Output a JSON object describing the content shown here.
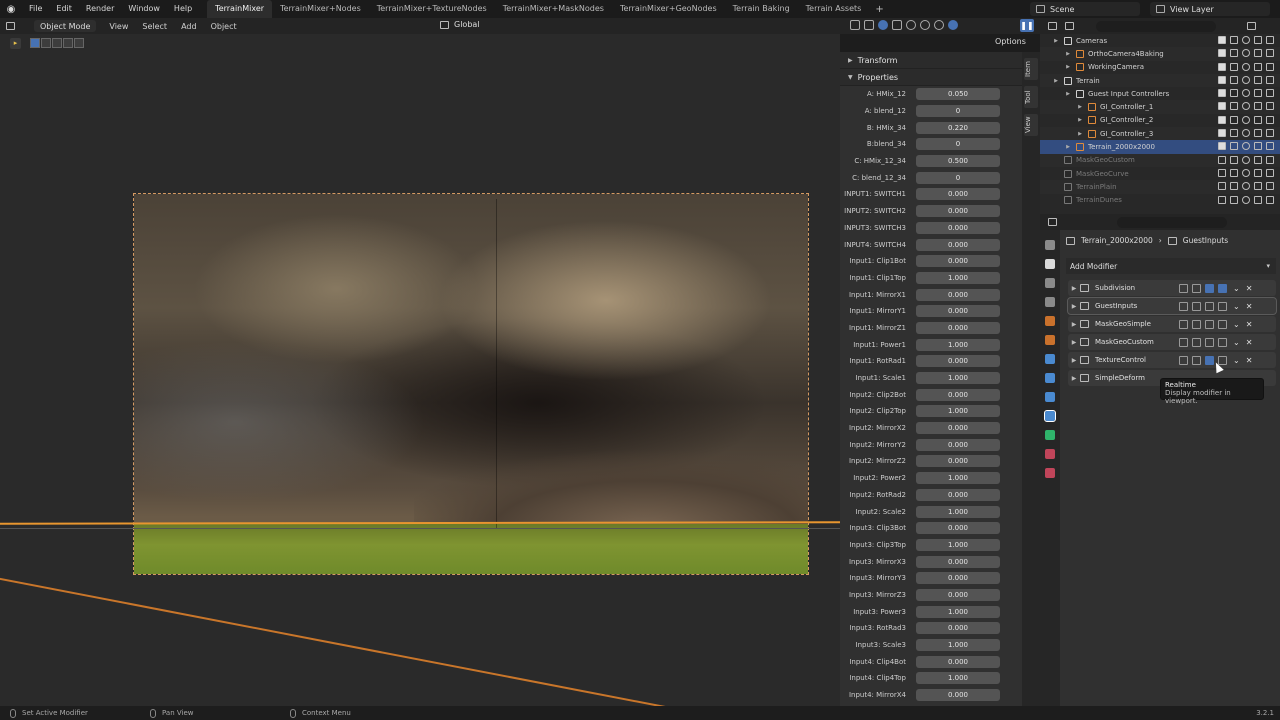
{
  "menubar": {
    "items": [
      "File",
      "Edit",
      "Render",
      "Window",
      "Help"
    ],
    "workspaces": [
      "TerrainMixer",
      "TerrainMixer+Nodes",
      "TerrainMixer+TextureNodes",
      "TerrainMixer+MaskNodes",
      "TerrainMixer+GeoNodes",
      "Terrain Baking",
      "Terrain Assets"
    ],
    "active_workspace": "TerrainMixer",
    "add_tab": "+",
    "scene": "Scene",
    "view_layer": "View Layer"
  },
  "viewport_header": {
    "mode": "Object Mode",
    "menus": [
      "View",
      "Select",
      "Add",
      "Object"
    ],
    "orientation": "Global",
    "options": "Options"
  },
  "sidebar": {
    "sections": {
      "transform": "Transform",
      "properties": "Properties"
    },
    "tabs": [
      "Item",
      "Tool",
      "View"
    ],
    "properties": [
      {
        "label": "A: HMix_12",
        "value": "0.050"
      },
      {
        "label": "A: blend_12",
        "value": "0"
      },
      {
        "label": "B: HMix_34",
        "value": "0.220"
      },
      {
        "label": "B:blend_34",
        "value": "0"
      },
      {
        "label": "C: HMix_12_34",
        "value": "0.500"
      },
      {
        "label": "C: blend_12_34",
        "value": "0"
      },
      {
        "label": "INPUT1: SWITCH1",
        "value": "0.000"
      },
      {
        "label": "INPUT2: SWITCH2",
        "value": "0.000"
      },
      {
        "label": "INPUT3: SWITCH3",
        "value": "0.000"
      },
      {
        "label": "INPUT4: SWITCH4",
        "value": "0.000"
      },
      {
        "label": "Input1: Clip1Bot",
        "value": "0.000"
      },
      {
        "label": "Input1: Clip1Top",
        "value": "1.000"
      },
      {
        "label": "Input1: MirrorX1",
        "value": "0.000"
      },
      {
        "label": "Input1: MirrorY1",
        "value": "0.000"
      },
      {
        "label": "Input1: MirrorZ1",
        "value": "0.000"
      },
      {
        "label": "Input1: Power1",
        "value": "1.000"
      },
      {
        "label": "Input1: RotRad1",
        "value": "0.000"
      },
      {
        "label": "Input1: Scale1",
        "value": "1.000"
      },
      {
        "label": "Input2: Clip2Bot",
        "value": "0.000"
      },
      {
        "label": "Input2: Clip2Top",
        "value": "1.000"
      },
      {
        "label": "Input2: MirrorX2",
        "value": "0.000"
      },
      {
        "label": "Input2: MirrorY2",
        "value": "0.000"
      },
      {
        "label": "Input2: MirrorZ2",
        "value": "0.000"
      },
      {
        "label": "Input2: Power2",
        "value": "1.000"
      },
      {
        "label": "Input2: RotRad2",
        "value": "0.000"
      },
      {
        "label": "Input2: Scale2",
        "value": "1.000"
      },
      {
        "label": "Input3: Clip3Bot",
        "value": "0.000"
      },
      {
        "label": "Input3: Clip3Top",
        "value": "1.000"
      },
      {
        "label": "Input3: MirrorX3",
        "value": "0.000"
      },
      {
        "label": "Input3: MirrorY3",
        "value": "0.000"
      },
      {
        "label": "Input3: MirrorZ3",
        "value": "0.000"
      },
      {
        "label": "Input3: Power3",
        "value": "1.000"
      },
      {
        "label": "Input3: RotRad3",
        "value": "0.000"
      },
      {
        "label": "Input3: Scale3",
        "value": "1.000"
      },
      {
        "label": "Input4: Clip4Bot",
        "value": "0.000"
      },
      {
        "label": "Input4: Clip4Top",
        "value": "1.000"
      },
      {
        "label": "Input4: MirrorX4",
        "value": "0.000"
      }
    ]
  },
  "outliner": {
    "rows": [
      {
        "label": "Cameras",
        "depth": 1,
        "icon": "collection-icon",
        "color": "#cfcfcf",
        "state": "normal"
      },
      {
        "label": "OrthoCamera4Baking",
        "depth": 2,
        "icon": "camera-icon",
        "color": "#e08a3a",
        "state": "normal"
      },
      {
        "label": "WorkingCamera",
        "depth": 2,
        "icon": "camera-icon",
        "color": "#e08a3a",
        "state": "normal"
      },
      {
        "label": "Terrain",
        "depth": 1,
        "icon": "collection-icon",
        "color": "#cfcfcf",
        "state": "normal"
      },
      {
        "label": "Guest Input Controllers",
        "depth": 2,
        "icon": "collection-icon",
        "color": "#cfcfcf",
        "state": "normal"
      },
      {
        "label": "GI_Controller_1",
        "depth": 3,
        "icon": "empty-icon",
        "color": "#e08a3a",
        "state": "normal"
      },
      {
        "label": "GI_Controller_2",
        "depth": 3,
        "icon": "empty-icon",
        "color": "#e08a3a",
        "state": "normal"
      },
      {
        "label": "GI_Controller_3",
        "depth": 3,
        "icon": "empty-icon",
        "color": "#e08a3a",
        "state": "normal"
      },
      {
        "label": "Terrain_2000x2000",
        "depth": 2,
        "icon": "mesh-icon",
        "color": "#e08a3a",
        "state": "selected"
      },
      {
        "label": "MaskGeoCustom",
        "depth": 1,
        "icon": "mesh-icon",
        "color": "#777777",
        "state": "dim"
      },
      {
        "label": "MaskGeoCurve",
        "depth": 1,
        "icon": "mesh-icon",
        "color": "#777777",
        "state": "dim"
      },
      {
        "label": "TerrainPlain",
        "depth": 1,
        "icon": "mesh-icon",
        "color": "#777777",
        "state": "dim"
      },
      {
        "label": "TerrainDunes",
        "depth": 1,
        "icon": "mesh-icon",
        "color": "#777777",
        "state": "dim"
      }
    ]
  },
  "properties_editor": {
    "object": "Terrain_2000x2000",
    "modifier": "GuestInputs",
    "add_modifier": "Add Modifier",
    "modifiers": [
      {
        "name": "Subdivision",
        "realtime_on": true
      },
      {
        "name": "GuestInputs",
        "realtime_on": false
      },
      {
        "name": "MaskGeoSimple",
        "realtime_on": false
      },
      {
        "name": "MaskGeoCustom",
        "realtime_on": false
      },
      {
        "name": "TextureControl",
        "realtime_on": true
      },
      {
        "name": "SimpleDeform",
        "realtime_on": false
      }
    ],
    "tooltip": {
      "title": "Realtime",
      "body": "Display modifier in viewport."
    },
    "tab_colors": [
      "#8a8a8a",
      "#d9d9d9",
      "#8a8a8a",
      "#8a8a8a",
      "#c9712c",
      "#c9712c",
      "#4a8ad0",
      "#4a8ad0",
      "#4a8ad0",
      "#4a8ad0",
      "#2fb36b",
      "#c0455a",
      "#c0455a"
    ]
  },
  "statusbar": {
    "hints": [
      "Set Active Modifier",
      "Pan View",
      "Context Menu"
    ],
    "version": "3.2.1"
  }
}
